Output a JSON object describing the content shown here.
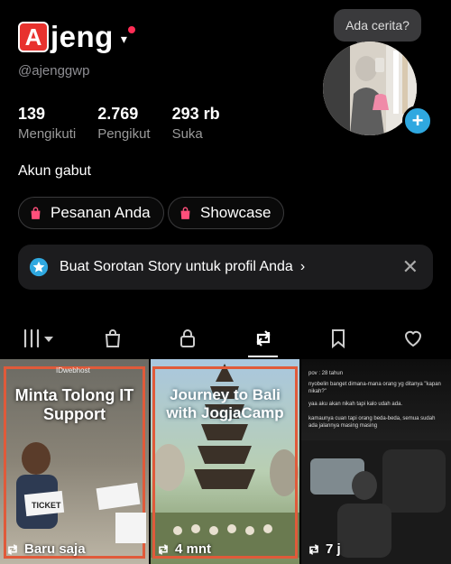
{
  "profile": {
    "name_initial": "A",
    "name_rest": "jeng",
    "caret": "▾",
    "handle": "@ajenggwp",
    "bio": "Akun gabut"
  },
  "stats": [
    {
      "value": "139",
      "label": "Mengikuti"
    },
    {
      "value": "2.769",
      "label": "Pengikut"
    },
    {
      "value": "293 rb",
      "label": "Suka"
    }
  ],
  "buttons": {
    "orders": "Pesanan Anda",
    "showcase": "Showcase"
  },
  "story_banner": {
    "text": "Buat Sorotan Story untuk profil Anda",
    "chevron": "›",
    "close": "✕"
  },
  "story_bubble": "Ada cerita?",
  "add_button": "+",
  "tabs": [
    "grid",
    "shop",
    "private",
    "repost",
    "saved",
    "liked"
  ],
  "active_tab": "repost",
  "videos": [
    {
      "title": "Minta Tolong IT Support",
      "brand": "IDwebhost",
      "sign": "TICKET",
      "time": "Baru saja"
    },
    {
      "title": "Journey to Bali with JogjaCamp",
      "time": "4 mnt"
    },
    {
      "caption_lines": [
        "pov : 28 tahun",
        "nyobelin banget dimana-mana orang yg ditanya \"kapan nikah?\"",
        "yaa aku akan nikah tapi kalo udah ada.",
        "kamaunya cuan tapi orang beda-beda, semua sudah ada jalannya masing masing"
      ],
      "time": "7 j"
    }
  ],
  "colors": {
    "accent_red": "#e8322e",
    "plus_blue": "#2fa8e0",
    "frame_orange": "#e05a3a"
  }
}
